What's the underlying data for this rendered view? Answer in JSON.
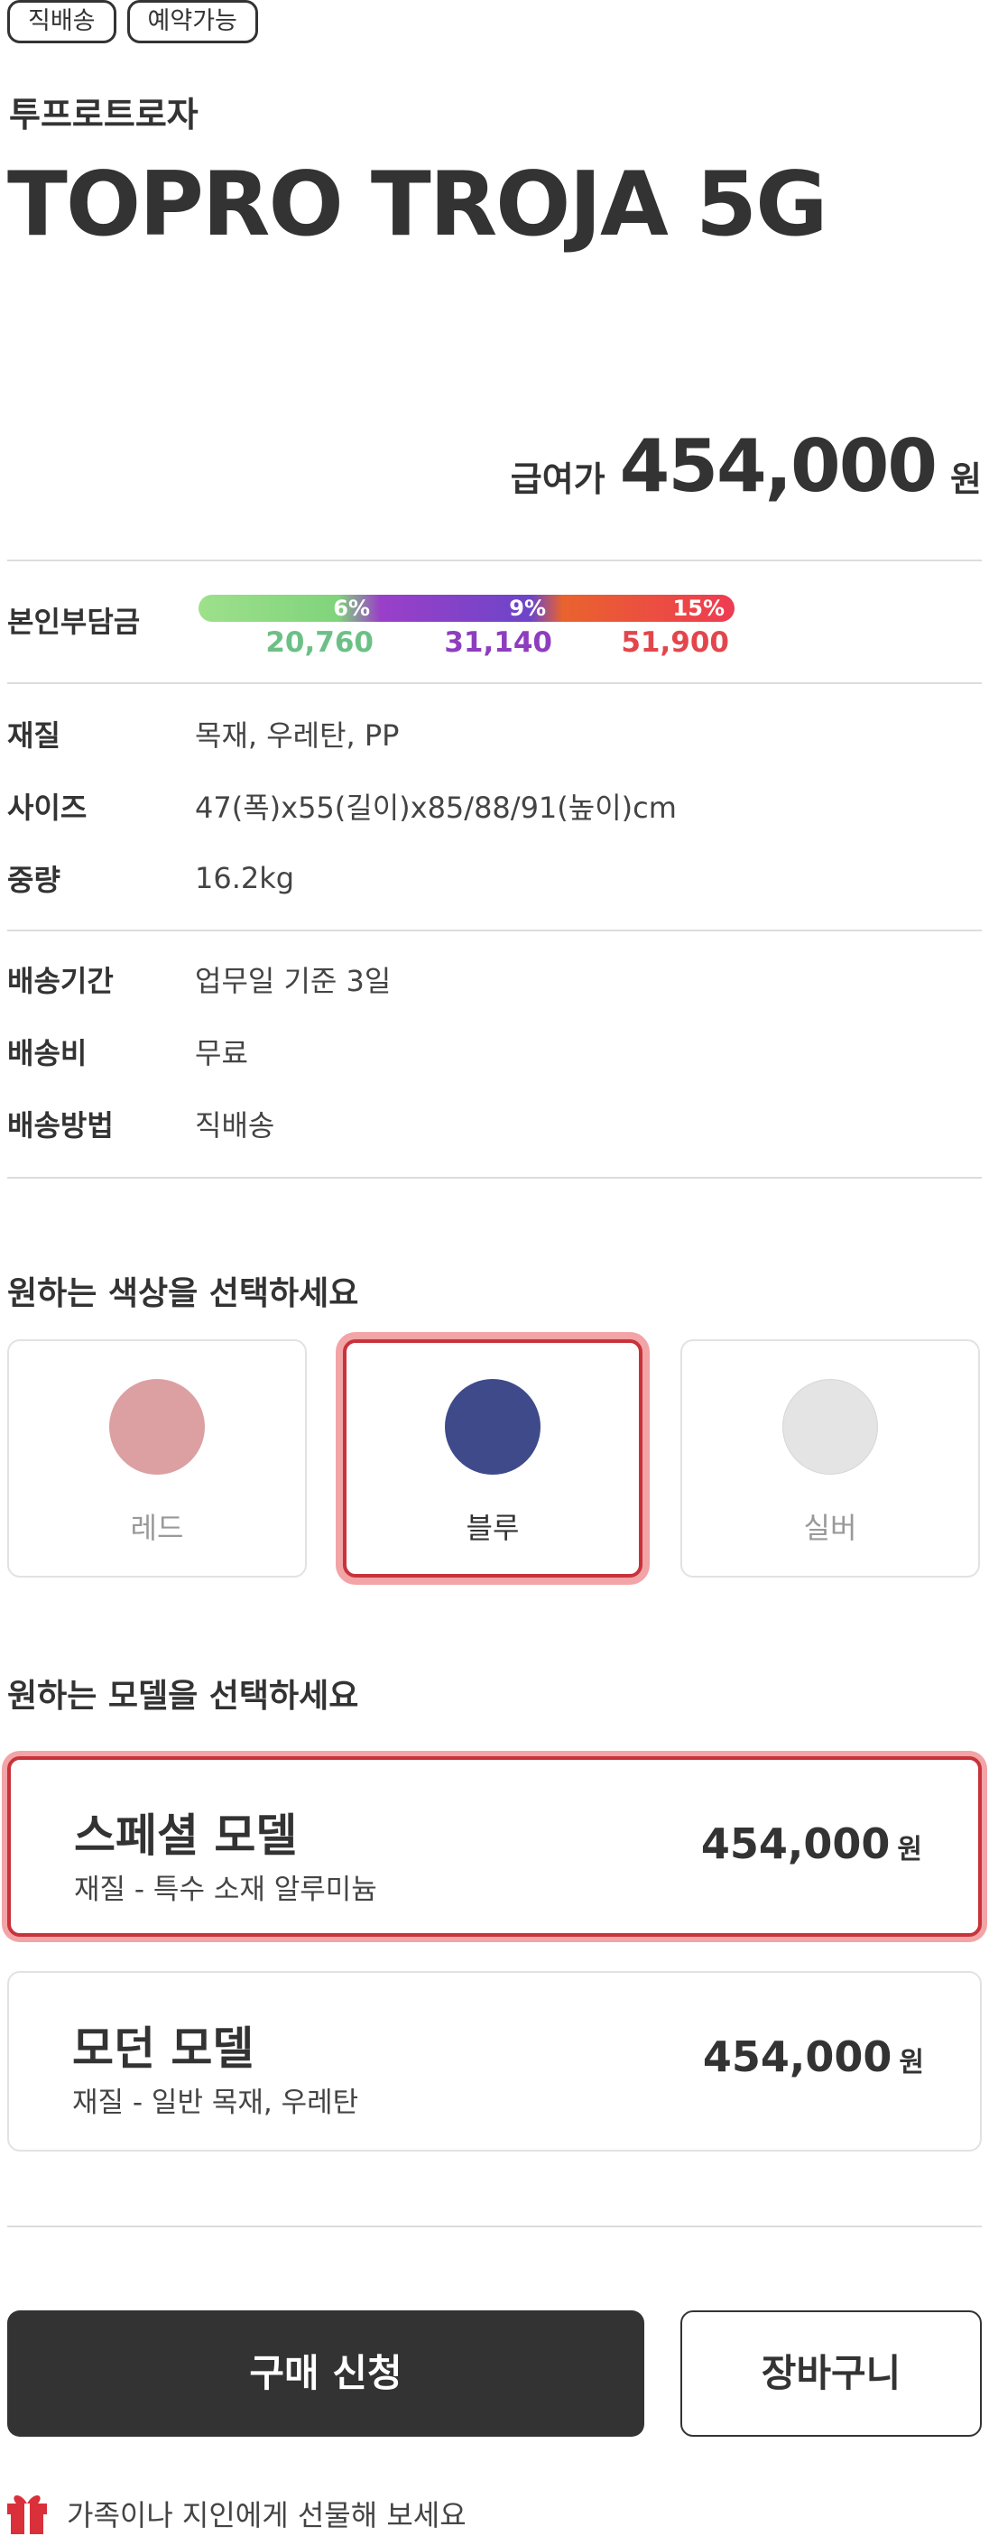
{
  "badges": [
    "직배송",
    "예약가능"
  ],
  "product": {
    "brand": "투프로트로자",
    "name": "TOPRO TROJA 5G"
  },
  "price": {
    "label": "급여가",
    "value": "454,000",
    "unit": "원"
  },
  "copay": {
    "label": "본인부담금",
    "tiers": [
      {
        "percent": "6%",
        "amount": "20,760",
        "color": "#6cc086"
      },
      {
        "percent": "9%",
        "amount": "31,140",
        "color": "#8e3dbf"
      },
      {
        "percent": "15%",
        "amount": "51,900",
        "color": "#e2464c"
      }
    ]
  },
  "specs": [
    {
      "label": "재질",
      "value": "목재, 우레탄, PP"
    },
    {
      "label": "사이즈",
      "value": "47(폭)x55(길이)x85/88/91(높이)cm"
    },
    {
      "label": "중량",
      "value": "16.2kg"
    }
  ],
  "delivery": [
    {
      "label": "배송기간",
      "value": "업무일 기준 3일"
    },
    {
      "label": "배송비",
      "value": "무료"
    },
    {
      "label": "배송방법",
      "value": "직배송"
    }
  ],
  "color_section": {
    "title": "원하는 색상을 선택하세요",
    "options": [
      {
        "name": "레드",
        "swatch": "#dca0a2",
        "selected": false
      },
      {
        "name": "블루",
        "swatch": "#3f4a8a",
        "selected": true
      },
      {
        "name": "실버",
        "swatch": "#e4e4e4",
        "selected": false
      }
    ]
  },
  "model_section": {
    "title": "원하는 모델을 선택하세요",
    "options": [
      {
        "name": "스페셜 모델",
        "desc": "재질 - 특수 소재 알루미늄",
        "price": "454,000",
        "unit": "원",
        "selected": true
      },
      {
        "name": "모던 모델",
        "desc": "재질 - 일반 목재, 우레탄",
        "price": "454,000",
        "unit": "원",
        "selected": false
      }
    ]
  },
  "actions": {
    "buy_label": "구매 신청",
    "cart_label": "장바구니"
  },
  "gift": {
    "text": "가족이나 지인에게 선물해 보세요",
    "icon": "gift-icon"
  },
  "colors": {
    "accent": "#c8333b",
    "accent_glow": "#f2a4a6",
    "dark_button": "#333333"
  }
}
